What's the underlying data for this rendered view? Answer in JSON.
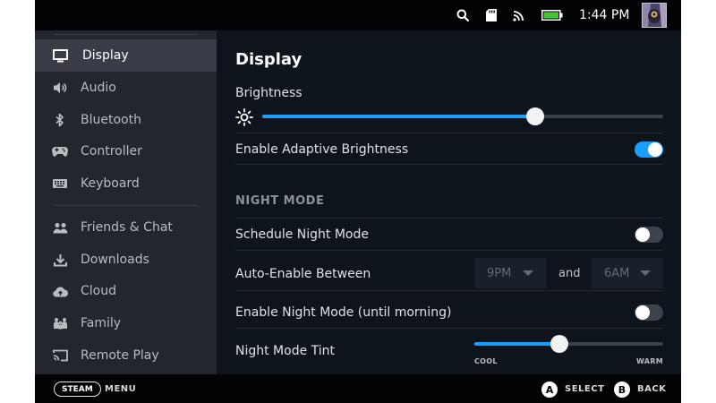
{
  "topbar": {
    "clock": "1:44 PM",
    "icons": [
      "search-icon",
      "sd-card-icon",
      "wifi-icon",
      "battery-icon"
    ],
    "battery_color": "#43c536"
  },
  "sidebar": {
    "items": [
      {
        "label": "Display",
        "icon": "monitor-icon",
        "active": true
      },
      {
        "label": "Audio",
        "icon": "speaker-icon"
      },
      {
        "label": "Bluetooth",
        "icon": "bluetooth-icon"
      },
      {
        "label": "Controller",
        "icon": "gamepad-icon"
      },
      {
        "label": "Keyboard",
        "icon": "keyboard-icon"
      },
      {
        "label": "Friends & Chat",
        "icon": "friends-icon"
      },
      {
        "label": "Downloads",
        "icon": "download-icon"
      },
      {
        "label": "Cloud",
        "icon": "cloud-icon"
      },
      {
        "label": "Family",
        "icon": "family-icon"
      },
      {
        "label": "Remote Play",
        "icon": "cast-icon"
      }
    ]
  },
  "main": {
    "title": "Display",
    "brightness": {
      "label": "Brightness",
      "value": 0.68
    },
    "adaptive": {
      "label": "Enable Adaptive Brightness",
      "on": true
    },
    "night_mode_header": "NIGHT MODE",
    "schedule": {
      "label": "Schedule Night Mode",
      "on": false
    },
    "auto_enable": {
      "label": "Auto-Enable Between",
      "from": "9PM",
      "and": "and",
      "to": "6AM"
    },
    "night_until_morning": {
      "label": "Enable Night Mode (until morning)",
      "on": false
    },
    "tint": {
      "label": "Night Mode Tint",
      "value": 0.45,
      "min_label": "COOL",
      "max_label": "WARM"
    }
  },
  "bottombar": {
    "steam": "STEAM",
    "menu": "MENU",
    "a": "A",
    "select": "SELECT",
    "b": "B",
    "back": "BACK"
  },
  "colors": {
    "accent": "#1a9fff"
  }
}
